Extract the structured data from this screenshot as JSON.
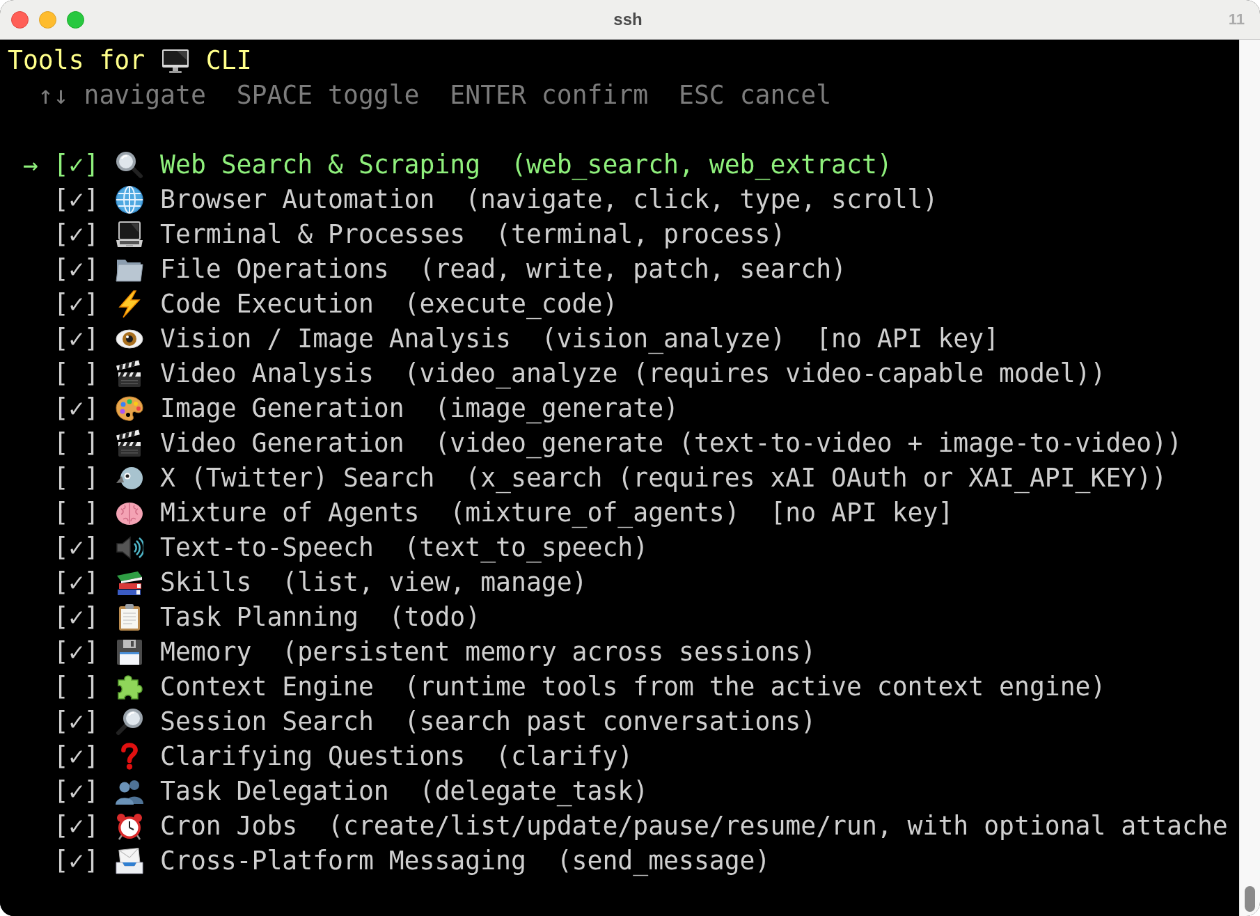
{
  "window": {
    "title": "ssh",
    "badge": "11"
  },
  "header": {
    "title_start": "Tools for",
    "title_end": "CLI",
    "hints": [
      "↑↓ navigate",
      "SPACE toggle",
      "ENTER confirm",
      "ESC cancel"
    ]
  },
  "checklist": {
    "cursor": "→",
    "checkbox_checked": "[✓]",
    "checkbox_unchecked": "[ ]",
    "items": [
      {
        "name": "Web Search & Scraping",
        "tools": "(web_search, web_extract)",
        "checked": true,
        "selected": true
      },
      {
        "name": "Browser Automation",
        "tools": "(navigate, click, type, scroll)",
        "checked": true,
        "selected": false
      },
      {
        "name": "Terminal & Processes",
        "tools": "(terminal, process)",
        "checked": true,
        "selected": false
      },
      {
        "name": "File Operations",
        "tools": "(read, write, patch, search)",
        "checked": true,
        "selected": false
      },
      {
        "name": "Code Execution",
        "tools": "(execute_code)",
        "checked": true,
        "selected": false
      },
      {
        "name": "Vision / Image Analysis",
        "tools": "(vision_analyze)",
        "note": "[no API key]",
        "checked": true,
        "selected": false
      },
      {
        "name": "Video Analysis",
        "tools": "(video_analyze (requires video-capable model))",
        "checked": false,
        "selected": false
      },
      {
        "name": "Image Generation",
        "tools": "(image_generate)",
        "checked": true,
        "selected": false
      },
      {
        "name": "Video Generation",
        "tools": "(video_generate (text-to-video + image-to-video))",
        "checked": false,
        "selected": false
      },
      {
        "name": "X (Twitter) Search",
        "tools": "(x_search (requires xAI OAuth or XAI_API_KEY))",
        "checked": false,
        "selected": false
      },
      {
        "name": "Mixture of Agents",
        "tools": "(mixture_of_agents)",
        "note": "[no API key]",
        "checked": false,
        "selected": false
      },
      {
        "name": "Text-to-Speech",
        "tools": "(text_to_speech)",
        "checked": true,
        "selected": false
      },
      {
        "name": "Skills",
        "tools": "(list, view, manage)",
        "checked": true,
        "selected": false
      },
      {
        "name": "Task Planning",
        "tools": "(todo)",
        "checked": true,
        "selected": false
      },
      {
        "name": "Memory",
        "tools": "(persistent memory across sessions)",
        "checked": true,
        "selected": false
      },
      {
        "name": "Context Engine",
        "tools": "(runtime tools from the active context engine)",
        "checked": false,
        "selected": false
      },
      {
        "name": "Session Search",
        "tools": "(search past conversations)",
        "checked": true,
        "selected": false
      },
      {
        "name": "Clarifying Questions",
        "tools": "(clarify)",
        "checked": true,
        "selected": false
      },
      {
        "name": "Task Delegation",
        "tools": "(delegate_task)",
        "checked": true,
        "selected": false
      },
      {
        "name": "Cron Jobs",
        "tools": "(create/list/update/pause/resume/run, with optional attache",
        "checked": true,
        "selected": false
      },
      {
        "name": "Cross-Platform Messaging",
        "tools": "(send_message)",
        "checked": true,
        "selected": false
      }
    ]
  }
}
